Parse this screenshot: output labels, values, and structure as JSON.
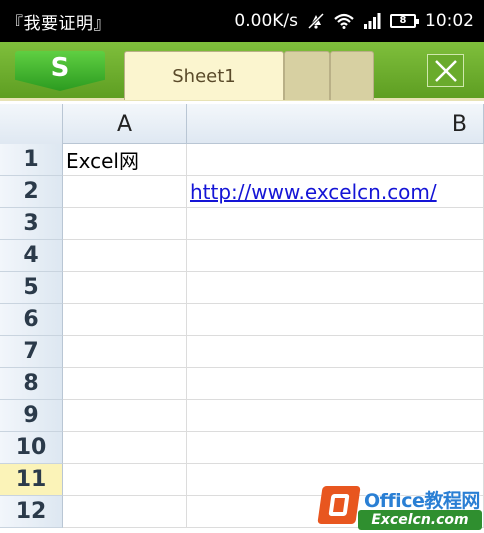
{
  "status_bar": {
    "title": "『我要证明』",
    "network_speed": "0.00K/s",
    "battery_level": "8",
    "time": "10:02",
    "icons": [
      "mute-icon",
      "wifi-icon",
      "signal-icon",
      "battery-icon"
    ]
  },
  "app": {
    "logo_letter": "S",
    "active_sheet": "Sheet1",
    "close_icon": "close-icon"
  },
  "grid": {
    "columns": [
      "A",
      "B"
    ],
    "selected_row": "11",
    "rows": [
      {
        "num": "1",
        "a": "Excel网",
        "b": ""
      },
      {
        "num": "2",
        "a": "",
        "b": "http://www.excelcn.com/"
      },
      {
        "num": "3",
        "a": "",
        "b": ""
      },
      {
        "num": "4",
        "a": "",
        "b": ""
      },
      {
        "num": "5",
        "a": "",
        "b": ""
      },
      {
        "num": "6",
        "a": "",
        "b": ""
      },
      {
        "num": "7",
        "a": "",
        "b": ""
      },
      {
        "num": "8",
        "a": "",
        "b": ""
      },
      {
        "num": "9",
        "a": "",
        "b": ""
      },
      {
        "num": "10",
        "a": "",
        "b": ""
      },
      {
        "num": "11",
        "a": "",
        "b": ""
      },
      {
        "num": "12",
        "a": "",
        "b": ""
      }
    ]
  },
  "watermark": {
    "title": "Office教程网",
    "url": "Excelcn.com"
  },
  "colors": {
    "toolbar_green": "#6aab2c",
    "active_tab": "#fbf5cf",
    "link_blue": "#1515d6",
    "selected_row_header": "#fbf3b8"
  }
}
